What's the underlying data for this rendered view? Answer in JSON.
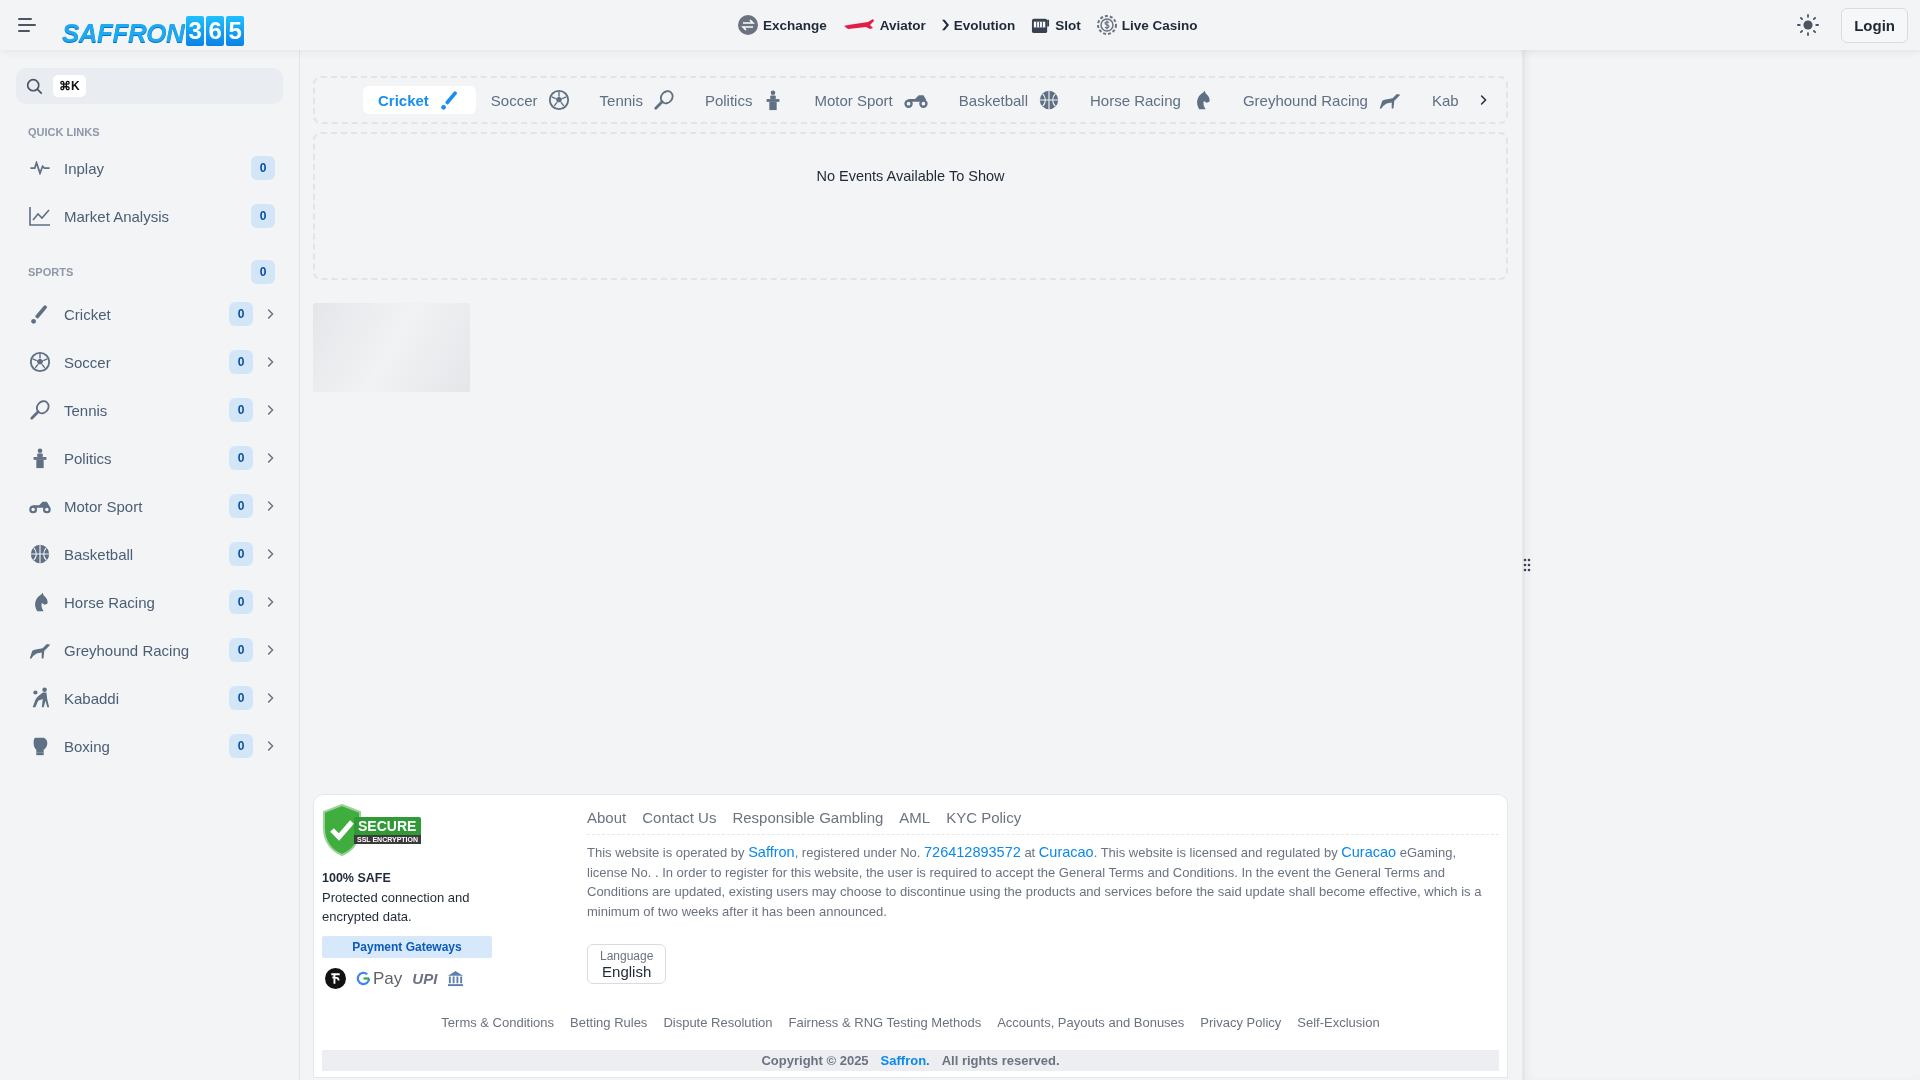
{
  "header": {
    "logo": {
      "word": "SAFFRON",
      "digits": [
        "3",
        "6",
        "5"
      ]
    },
    "nav": [
      {
        "label": "Exchange"
      },
      {
        "label": "Aviator"
      },
      {
        "label": "Evolution"
      },
      {
        "label": "Slot"
      },
      {
        "label": "Live Casino"
      }
    ],
    "login": "Login"
  },
  "sidebar": {
    "search": {
      "shortcut": "⌘K"
    },
    "quick_links": {
      "title": "QUICK LINKS",
      "items": [
        {
          "label": "Inplay",
          "count": "0"
        },
        {
          "label": "Market Analysis",
          "count": "0"
        }
      ]
    },
    "sports": {
      "title": "SPORTS",
      "count": "0",
      "items": [
        {
          "label": "Cricket",
          "count": "0"
        },
        {
          "label": "Soccer",
          "count": "0"
        },
        {
          "label": "Tennis",
          "count": "0"
        },
        {
          "label": "Politics",
          "count": "0"
        },
        {
          "label": "Motor Sport",
          "count": "0"
        },
        {
          "label": "Basketball",
          "count": "0"
        },
        {
          "label": "Horse Racing",
          "count": "0"
        },
        {
          "label": "Greyhound Racing",
          "count": "0"
        },
        {
          "label": "Kabaddi",
          "count": "0"
        },
        {
          "label": "Boxing",
          "count": "0"
        }
      ]
    }
  },
  "tabs": [
    {
      "label": "Cricket",
      "selected": true
    },
    {
      "label": "Soccer",
      "selected": false
    },
    {
      "label": "Tennis",
      "selected": false
    },
    {
      "label": "Politics",
      "selected": false
    },
    {
      "label": "Motor Sport",
      "selected": false
    },
    {
      "label": "Basketball",
      "selected": false
    },
    {
      "label": "Horse Racing",
      "selected": false
    },
    {
      "label": "Greyhound Racing",
      "selected": false
    },
    {
      "label": "Kab",
      "selected": false
    }
  ],
  "events": {
    "empty_message": "No Events Available To Show"
  },
  "footer": {
    "secure_badge": {
      "title": "SECURE",
      "subtitle": "SSL ENCRYPTION"
    },
    "safe_title": "100% SAFE",
    "safe_text": "Protected connection and encrypted data.",
    "payment_title": "Payment Gateways",
    "gpay_label": "Pay",
    "upi_label": "UPI",
    "top_links": [
      "About",
      "Contact Us",
      "Responsible Gambling",
      "AML",
      "KYC Policy"
    ],
    "notice": [
      {
        "text": "This website is operated by ",
        "link": false
      },
      {
        "text": "Saffron",
        "link": true
      },
      {
        "text": ", registered under No. ",
        "link": false
      },
      {
        "text": "726412893572",
        "link": true
      },
      {
        "text": " at ",
        "link": false
      },
      {
        "text": "Curacao",
        "link": true
      },
      {
        "text": ". This website is licensed and regulated by ",
        "link": false
      },
      {
        "text": "Curacao",
        "link": true
      },
      {
        "text": " eGaming, license No. . In order to register for this website, the user is required to accept the General Terms and Conditions. In the event the General Terms and Conditions are updated, existing users may choose to discontinue using the products and services before the said update shall become effective, which is a minimum of two weeks after it has been announced.",
        "link": false
      }
    ],
    "language": {
      "label": "Language",
      "value": "English"
    },
    "bottom_links": [
      "Terms & Conditions",
      "Betting Rules",
      "Dispute Resolution",
      "Fairness & RNG Testing Methods",
      "Accounts, Payouts and Bonuses",
      "Privacy Policy",
      "Self-Exclusion"
    ],
    "copyright": {
      "text": "Copyright © 2025",
      "brand": "Saffron.",
      "rights": "All rights reserved."
    }
  }
}
